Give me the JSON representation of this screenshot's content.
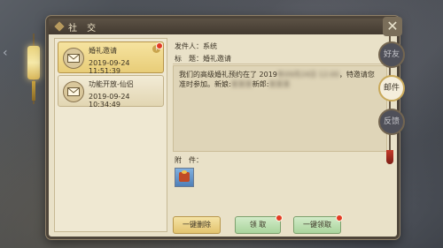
{
  "window": {
    "title": "社 交"
  },
  "mail_list": [
    {
      "title": "婚礼邀请",
      "time": "2019-09-24 11:51:39",
      "badge": "!",
      "selected": true
    },
    {
      "title": "功能开放-仙侣",
      "time": "2019-09-24 10:34:49",
      "selected": false
    }
  ],
  "detail": {
    "sender_label": "发件人：",
    "sender": "系统",
    "subject_label": "标　题：",
    "subject": "婚礼邀请",
    "body_line1_a": "我们的高级婚礼预约在了 2019",
    "body_line1_blur": "年09月24日 12:00",
    "body_line1_b": "，特邀请您",
    "body_line2_a": "准时参加。新娘:",
    "body_line2_blur": "某某某",
    "body_line2_b": "新郎:",
    "body_line2_blur2": "某某某",
    "attachment_label": "附　件：",
    "attachment_icon": "gift-box-icon"
  },
  "buttons": {
    "delete_all": "一键删除",
    "claim": "领 取",
    "claim_all": "一键领取"
  },
  "tabs": [
    {
      "label": "好友",
      "active": false
    },
    {
      "label": "邮件",
      "active": true
    },
    {
      "label": "反馈",
      "active": false
    }
  ],
  "colors": {
    "panel_bg": "#e9e1c8",
    "selected_item": "#f6e3a0",
    "claim_button": "#a9d49c",
    "notify_dot": "#e23b25"
  }
}
